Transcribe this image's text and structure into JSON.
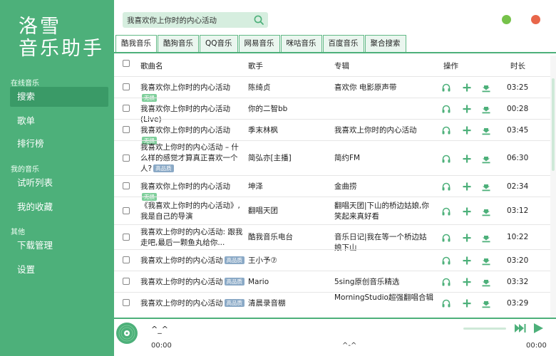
{
  "app": {
    "logo_line1": "洛雪",
    "logo_line2": "音乐助手"
  },
  "sidebar": {
    "section_online": "在线音乐",
    "section_mine": "我的音乐",
    "section_other": "其他",
    "items": {
      "search": "搜索",
      "playlist": "歌单",
      "ranking": "排行榜",
      "trial": "试听列表",
      "favorites": "我的收藏",
      "downloads": "下载管理",
      "settings": "设置"
    }
  },
  "search": {
    "value": "我喜欢你上你时的内心活动"
  },
  "tabs": [
    "酷我音乐",
    "酷狗音乐",
    "QQ音乐",
    "网易音乐",
    "咪咕音乐",
    "百度音乐",
    "聚合搜索"
  ],
  "table": {
    "headers": {
      "title": "歌曲名",
      "singer": "歌手",
      "album": "专辑",
      "actions": "操作",
      "duration": "时长"
    },
    "rows": [
      {
        "title": "我喜欢你上你时的内心活动",
        "badge": "无损",
        "singer": "陈绮贞",
        "album": "喜欢你 电影原声带",
        "duration": "03:25"
      },
      {
        "title": "我喜欢你上你时的内心活动(Live)",
        "badge": "",
        "singer": "你的二智bb",
        "album": "",
        "duration": "00:28"
      },
      {
        "title": "我喜欢你上你时的内心活动",
        "badge": "无损",
        "singer": "季末林枫",
        "album": "我喜欢上你时的内心活动",
        "duration": "03:45"
      },
      {
        "title": "我喜欢上你时的内心活动 – 什么样的感觉才算真正喜欢一个人?",
        "badge": "高品质",
        "singer": "简弘亦[主播]",
        "album": "简约FM",
        "duration": "06:30"
      },
      {
        "title": "我喜欢你上你时的内心活动",
        "badge": "无损",
        "singer": "坤泽",
        "album": "金曲捞",
        "duration": "02:34"
      },
      {
        "title": "《我喜欢上你时的内心活动》,我是自己的导演",
        "badge": "",
        "singer": "翻唱天团",
        "album": "翻唱天团|下山的桥边姑娘,你笑起来真好看",
        "duration": "03:12"
      },
      {
        "title": "我喜欢上你时的内心活动: 跟我走吧,最后一颗鱼丸给你...",
        "badge": "",
        "singer": "酷我音乐电台",
        "album": "音乐日记|我在等一个桥边姑娘下山",
        "duration": "10:22"
      },
      {
        "title": "我喜欢上你时的内心活动",
        "badge": "高品质",
        "singer": "王小予⑦",
        "album": "",
        "duration": "03:20"
      },
      {
        "title": "我喜欢上你时的内心活动",
        "badge": "高品质",
        "singer": "Mario",
        "album": "5sing原创音乐精选",
        "duration": "03:32"
      },
      {
        "title": "我喜欢上你时的内心活动",
        "badge": "高品质",
        "singer": "清晨录音棚",
        "album": "MorningStudio超强翻唱合辑",
        "duration": "03:29"
      }
    ]
  },
  "player": {
    "title": "^_^",
    "time_current": "00:00",
    "status": "^-^",
    "time_total": "00:00"
  },
  "colors": {
    "accent": "#4db07a",
    "accent_dark": "#3a9a67",
    "badge_lossless": "#7fcf9b",
    "badge_hq": "#8aa9c6"
  }
}
